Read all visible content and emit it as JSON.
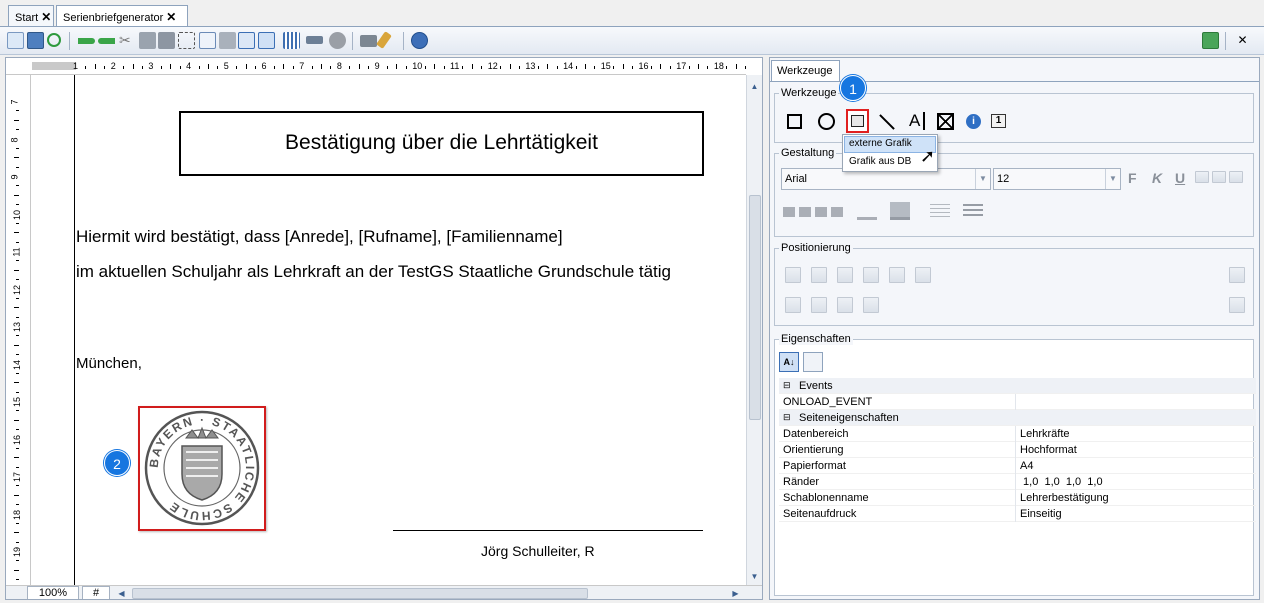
{
  "tabs": [
    {
      "label": "Start",
      "close": "✕"
    },
    {
      "label": "Serienbriefgenerator",
      "close": "✕"
    }
  ],
  "window_close": "✕",
  "ruler": {
    "top_numbers": [
      "1",
      "2",
      "3",
      "4",
      "5",
      "6",
      "7",
      "8",
      "9",
      "10",
      "11",
      "12",
      "13",
      "14",
      "15",
      "16",
      "17",
      "18"
    ],
    "left_numbers": [
      "7",
      "8",
      "9",
      "10",
      "11",
      "12",
      "13",
      "14",
      "15",
      "16",
      "17",
      "18",
      "19"
    ]
  },
  "document": {
    "title": "Bestätigung über die Lehrtätigkeit",
    "line1": "Hiermit wird bestätigt, dass [Anrede], [Rufname], [Familienname]",
    "line2": "im aktuellen Schuljahr als Lehrkraft an der TestGS Staatliche Grundschule tätig",
    "place": "München,",
    "signature": "Jörg Schulleiter, R",
    "seal_text": "BAYERN · STAATLICHE SCHULE"
  },
  "zoom": "100%",
  "grid_symbol": "#",
  "panel": {
    "tab_label": "Werkzeuge",
    "tools_group": "Werkzeuge",
    "tool_text_letter": "A",
    "tool_counter_label": "1",
    "dropdown": [
      "externe Grafik",
      "Grafik aus DB"
    ],
    "design_group": "Gestaltung",
    "font_value": "Arial",
    "size_value": "12",
    "bold_label": "F",
    "italic_label": "K",
    "underline_label": "U",
    "position_group": "Positionierung",
    "props_group": "Eigenschaften",
    "props": {
      "cat_events": "Events",
      "onload": "ONLOAD_EVENT",
      "cat_page": "Seiteneigenschaften",
      "rows": [
        {
          "key": "Datenbereich",
          "value": "Lehrkräfte"
        },
        {
          "key": "Orientierung",
          "value": "Hochformat"
        },
        {
          "key": "Papierformat",
          "value": "A4"
        },
        {
          "key": "Ränder",
          "value": " 1,0  1,0  1,0  1,0"
        },
        {
          "key": "Schablonenname",
          "value": "Lehrerbestätigung"
        },
        {
          "key": "Seitenaufdruck",
          "value": "Einseitig"
        }
      ]
    }
  },
  "badges": [
    "1",
    "2"
  ],
  "colors": {
    "badge": "#1676e0",
    "highlight": "#e02020",
    "tab_active": "#ffffff"
  }
}
